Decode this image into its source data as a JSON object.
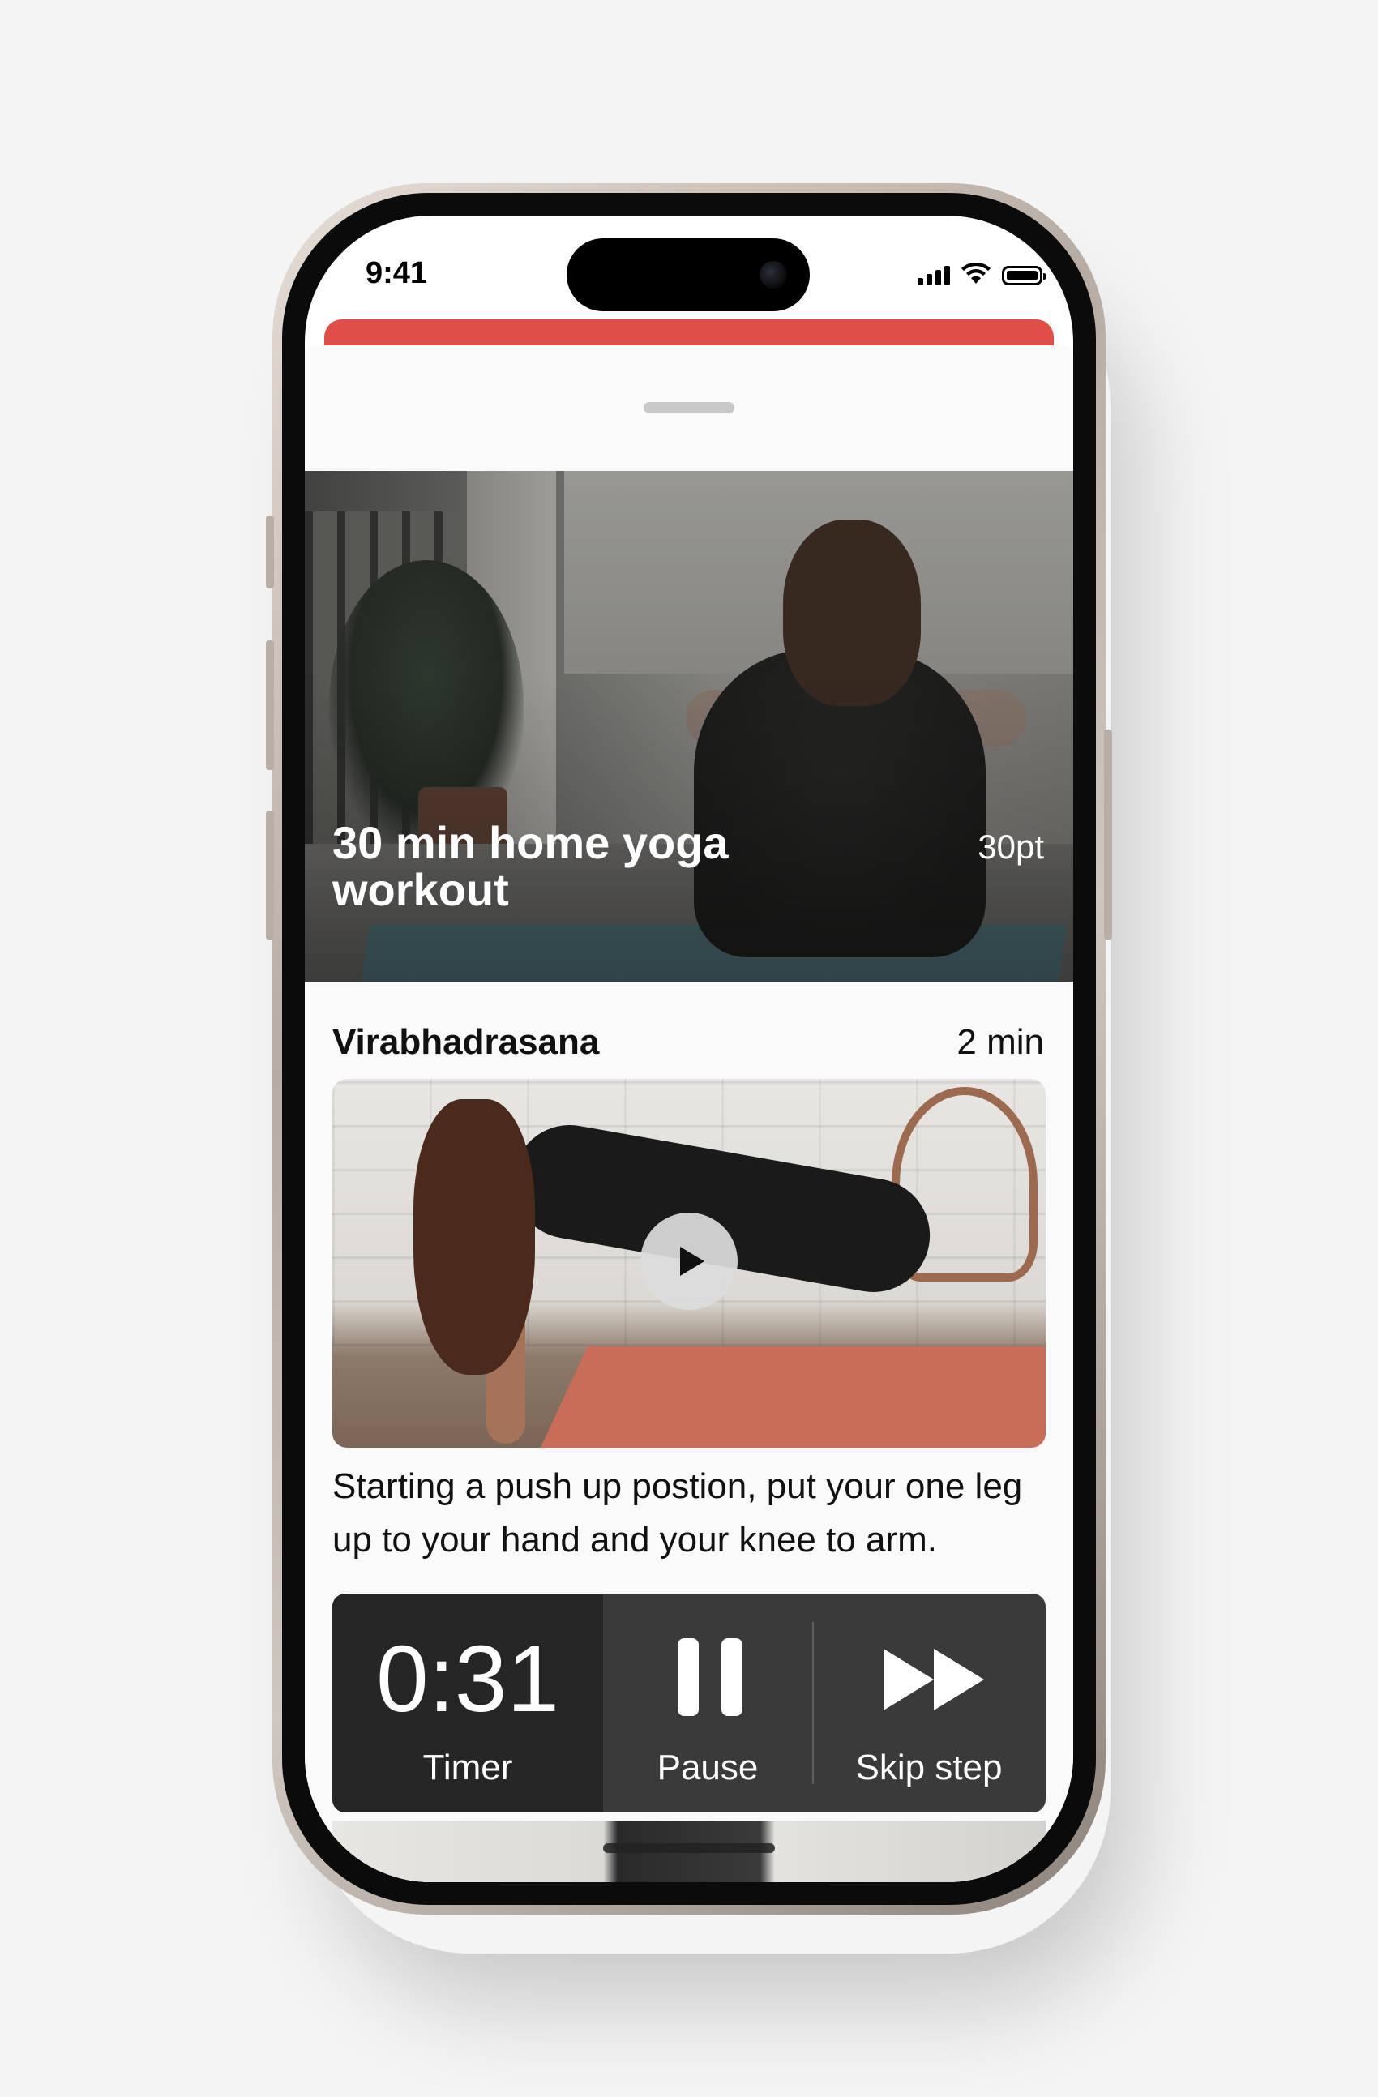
{
  "status_bar": {
    "time": "9:41"
  },
  "workout": {
    "title": "30 min home yoga workout",
    "points": "30pt"
  },
  "step": {
    "name": "Virabhadrasana",
    "duration": "2 min",
    "instructions": "Starting a push up postion, put your one leg up to your hand and your knee to arm."
  },
  "controls": {
    "timer_value": "0:31",
    "timer_label": "Timer",
    "pause_label": "Pause",
    "skip_label": "Skip step"
  },
  "colors": {
    "accent": "#de4e46",
    "controls_bg": "#3a3a3a",
    "timer_bg": "#262626"
  },
  "icons": [
    "signal-icon",
    "wifi-icon",
    "battery-icon",
    "play-icon",
    "pause-icon",
    "skip-forward-icon"
  ]
}
